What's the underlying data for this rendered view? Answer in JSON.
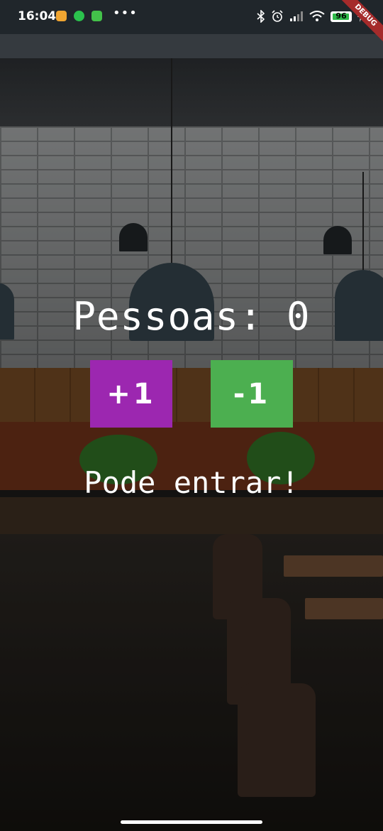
{
  "status_bar": {
    "time": "16:04",
    "dots": "•••",
    "battery": "96",
    "notification_icons": [
      "message-icon",
      "whatsapp-icon",
      "app-icon"
    ],
    "system_icons": [
      "bluetooth-icon",
      "alarm-icon",
      "signal-icon",
      "wifi-icon",
      "battery-icon",
      "charging-icon"
    ]
  },
  "debug_banner": "DEBUG",
  "counter": {
    "label": "Pessoas: 0",
    "value": 0
  },
  "buttons": {
    "increment_label": "+1",
    "decrement_label": "-1"
  },
  "message": "Pode entrar!",
  "colors": {
    "increment_button": "#9c27b0",
    "decrement_button": "#4caf50",
    "text": "#ffffff",
    "status_bar": "#20262b"
  }
}
